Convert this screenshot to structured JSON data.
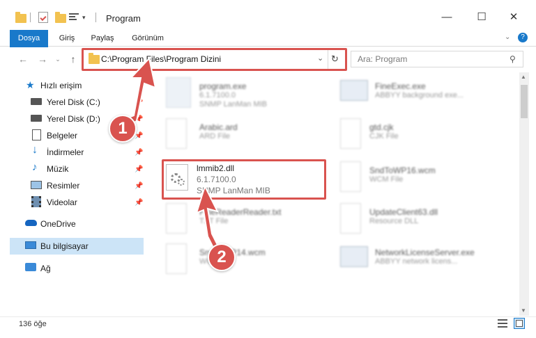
{
  "window": {
    "title": "Program",
    "minimize": "—",
    "maximize": "☐",
    "close": "✕"
  },
  "ribbon": {
    "tabs": [
      "Dosya",
      "Giriş",
      "Paylaş",
      "Görünüm"
    ],
    "help": "?"
  },
  "address": {
    "path": "C:\\Program Files\\Program Dizini",
    "search_placeholder": "Ara: Program"
  },
  "sidebar": {
    "quick_access": "Hızlı erişim",
    "items": [
      {
        "label": "Yerel Disk (C:)",
        "pinned": true
      },
      {
        "label": "Yerel Disk (D:)",
        "pinned": true
      },
      {
        "label": "Belgeler",
        "pinned": true
      },
      {
        "label": "İndirmeler",
        "pinned": true
      },
      {
        "label": "Müzik",
        "pinned": true
      },
      {
        "label": "Resimler",
        "pinned": true
      },
      {
        "label": "Videolar",
        "pinned": true
      }
    ],
    "onedrive": "OneDrive",
    "this_pc": "Bu bilgisayar",
    "network": "Ağ"
  },
  "files": [
    {
      "name": "program.exe",
      "version": "6.1.7100.0",
      "desc": "SNMP LanMan MIB"
    },
    {
      "name": "FineExec.exe",
      "version": "ABBYY background exe...",
      "desc": ""
    },
    {
      "name": "Arabic.ard",
      "version": "ARD File",
      "desc": ""
    },
    {
      "name": "gtd.cjk",
      "version": "CJK File",
      "desc": ""
    },
    {
      "name": "lmmib2.dll",
      "version": "6.1.7100.0",
      "desc": "SNMP LanMan MIB"
    },
    {
      "name": "SndToWP16.wcm",
      "version": "WCM File",
      "desc": ""
    },
    {
      "name": "FineReaderReader.txt",
      "version": "TXT File",
      "desc": ""
    },
    {
      "name": "UpdateClient63.dll",
      "version": "Resource DLL",
      "desc": ""
    },
    {
      "name": "SndToWP14.wcm",
      "version": "WCM File",
      "desc": ""
    },
    {
      "name": "NetworkLicenseServer.exe",
      "version": "ABBYY network licens...",
      "desc": ""
    }
  ],
  "status": {
    "count": "136 öğe"
  },
  "annotations": [
    "1",
    "2"
  ]
}
